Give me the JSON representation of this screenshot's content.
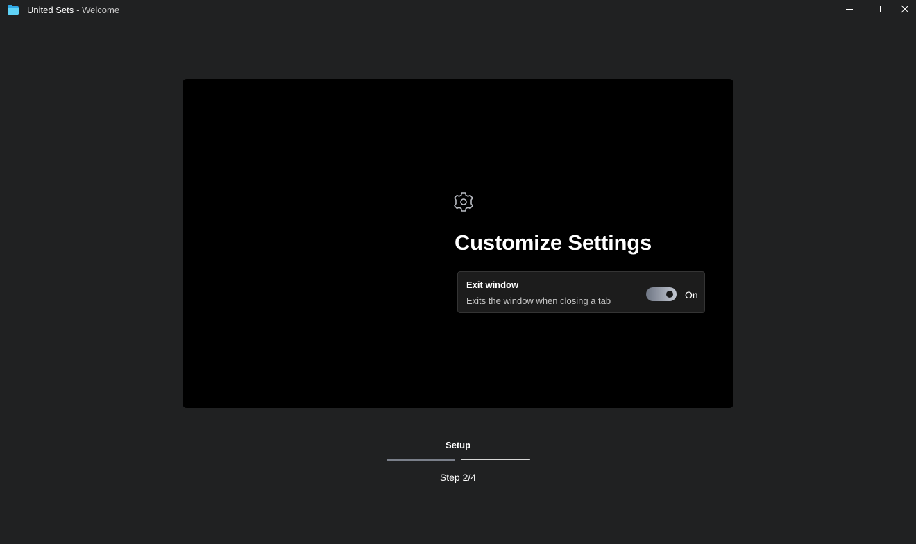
{
  "window": {
    "app_name": "United Sets",
    "subtitle": "- Welcome",
    "app_icon": "folder-icon",
    "controls": [
      "minimize-icon",
      "maximize-icon",
      "close-icon"
    ]
  },
  "page": {
    "icon": "gear-icon",
    "heading": "Customize Settings"
  },
  "setting": {
    "title": "Exit window",
    "description": "Exits the window when closing a tab",
    "state_label": "On",
    "enabled": true,
    "accent_color": "#c3c8d2"
  },
  "progress": {
    "label": "Setup",
    "step_text": "Step 2/4",
    "current_step": 2,
    "total_steps": 4
  }
}
